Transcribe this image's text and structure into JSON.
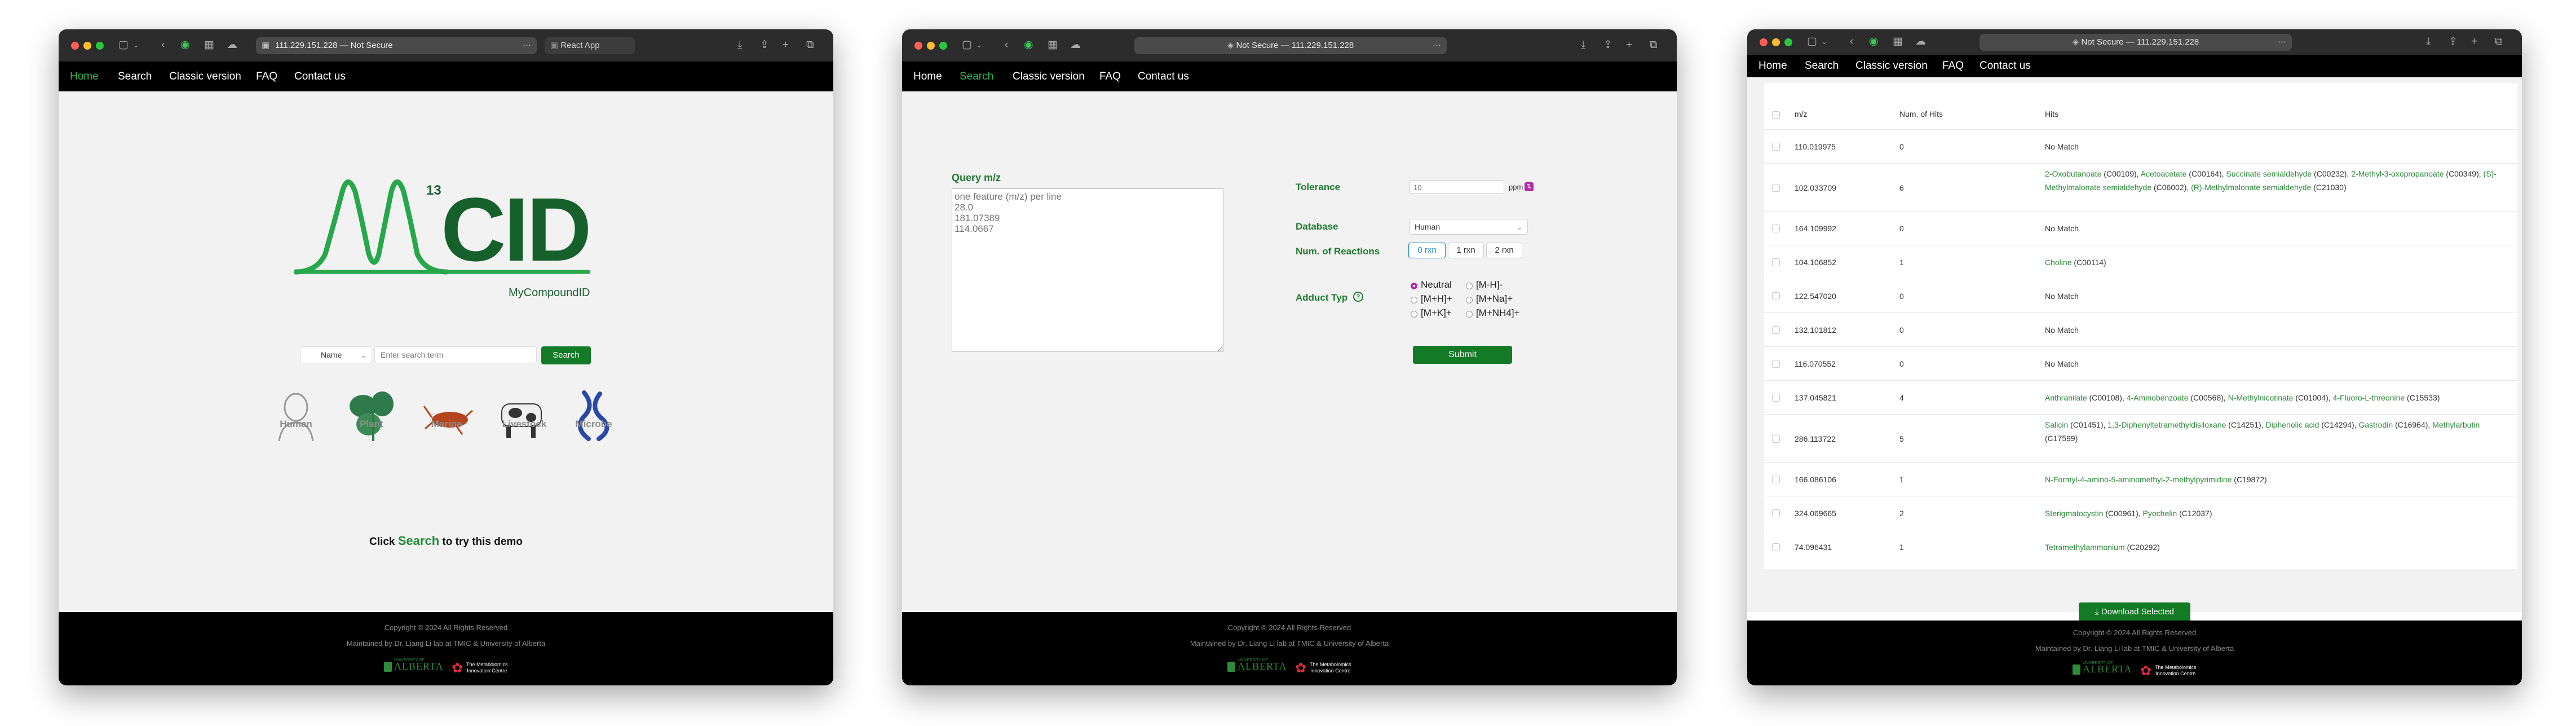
{
  "windows": [
    {
      "address": "111.229.151.228 — Not Secure",
      "tab2": "React App",
      "nav": [
        "Home",
        "Search",
        "Classic version",
        "FAQ",
        "Contact us"
      ],
      "active_nav": 0
    },
    {
      "address": "Not Secure — 111.229.151.228",
      "nav": [
        "Home",
        "Search",
        "Classic version",
        "FAQ",
        "Contact us"
      ],
      "active_nav": 1
    },
    {
      "address": "Not Secure — 111.229.151.228",
      "nav": [
        "Home",
        "Search",
        "Classic version",
        "FAQ",
        "Contact us"
      ],
      "active_nav": -1
    }
  ],
  "home": {
    "logo_main": "CID",
    "logo_super": "13",
    "logo_sub": "MyCompoundID",
    "search_type": "Name",
    "search_placeholder": "Enter search term",
    "search_button": "Search",
    "organisms": [
      "Human",
      "Plant",
      "Marine",
      "Livestock",
      "Microbe"
    ],
    "cta_prefix": "Click",
    "cta_link": "Search",
    "cta_suffix": "to try this demo"
  },
  "search": {
    "query_label": "Query m/z",
    "query_placeholder": "one feature (m/z) per line\n28.0\n181.07389\n114.0667",
    "tolerance_label": "Tolerance",
    "tolerance_placeholder": "10",
    "tolerance_unit": "ppm",
    "database_label": "Database",
    "database_value": "Human",
    "reactions_label": "Num. of Reactions",
    "reactions": [
      "0 rxn",
      "1 rxn",
      "2 rxn"
    ],
    "adduct_label": "Adduct Typ",
    "adducts": [
      "Neutral",
      "[M-H]-",
      "[M+H]+",
      "[M+Na]+",
      "[M+K]+",
      "[M+NH4]+"
    ],
    "submit": "Submit"
  },
  "results": {
    "headers": [
      "m/z",
      "Num. of Hits",
      "Hits"
    ],
    "rows": [
      {
        "mz": "110.019975",
        "n": "0",
        "hits": [],
        "none": "No Match"
      },
      {
        "mz": "102.033709",
        "n": "6",
        "hits": [
          {
            "name": "2-Oxobutanoate",
            "id": " (C00109), "
          },
          {
            "name": "Acetoacetate",
            "id": " (C00164), "
          },
          {
            "name": "Succinate semialdehyde",
            "id": " (C00232), "
          },
          {
            "name": "2-Methyl-3-oxopropanoate",
            "id": " (C00349), "
          },
          {
            "name": "(S)-Methylmalonate semialdehyde",
            "id": " (C06002), "
          },
          {
            "name": "(R)-Methylmalonate semialdehyde",
            "id": " (C21030)"
          }
        ],
        "none": ""
      },
      {
        "mz": "164.109992",
        "n": "0",
        "hits": [],
        "none": "No Match"
      },
      {
        "mz": "104.106852",
        "n": "1",
        "hits": [
          {
            "name": "Choline",
            "id": " (C00114)"
          }
        ],
        "none": ""
      },
      {
        "mz": "122.547020",
        "n": "0",
        "hits": [],
        "none": "No Match"
      },
      {
        "mz": "132.101812",
        "n": "0",
        "hits": [],
        "none": "No Match"
      },
      {
        "mz": "116.070552",
        "n": "0",
        "hits": [],
        "none": "No Match"
      },
      {
        "mz": "137.045821",
        "n": "4",
        "hits": [
          {
            "name": "Anthranilate",
            "id": " (C00108), "
          },
          {
            "name": "4-Aminobenzoate",
            "id": " (C00568), "
          },
          {
            "name": "N-Methylnicotinate",
            "id": " (C01004), "
          },
          {
            "name": "4-Fluoro-L-threonine",
            "id": " (C15533)"
          }
        ],
        "none": ""
      },
      {
        "mz": "286.113722",
        "n": "5",
        "hits": [
          {
            "name": "Salicin",
            "id": " (C01451), "
          },
          {
            "name": "1,3-Diphenyltetramethyldisiloxane",
            "id": " (C14251), "
          },
          {
            "name": "Diphenolic acid",
            "id": " (C14294), "
          },
          {
            "name": "Gastrodin",
            "id": " (C16964), "
          },
          {
            "name": "Methylarbutin",
            "id": " (C17599)"
          }
        ],
        "none": ""
      },
      {
        "mz": "166.086106",
        "n": "1",
        "hits": [
          {
            "name": "N-Formyl-4-amino-5-aminomethyl-2-methylpyrimidine",
            "id": " (C19872)"
          }
        ],
        "none": ""
      },
      {
        "mz": "324.069665",
        "n": "2",
        "hits": [
          {
            "name": "Sterigmatocystin",
            "id": " (C00961), "
          },
          {
            "name": "Pyochelin",
            "id": " (C12037)"
          }
        ],
        "none": ""
      },
      {
        "mz": "74.096431",
        "n": "1",
        "hits": [
          {
            "name": "Tetramethylammonium",
            "id": " (C20292)"
          }
        ],
        "none": ""
      }
    ],
    "download": "Download Selected"
  },
  "footer": {
    "copyright": "Copyright © 2024 All Rights Reserved",
    "maintained": "Maintained by Dr. Liang Li lab at TMIC & University of Alberta",
    "ua_logo": "ALBERTA",
    "ua_small": "UNIVERSITY OF",
    "tmic_line1": "The Metabolomics",
    "tmic_line2": "Innovation Centre"
  },
  "colors": {
    "brand_green": "#1f7a2e",
    "nav_active": "#2eb84a",
    "button_green": "#137a26"
  },
  "icons": [
    "sidebar-icon",
    "back-icon",
    "shield-icon",
    "download-icon",
    "share-icon",
    "plus-icon",
    "tabs-icon",
    "info-icon"
  ]
}
